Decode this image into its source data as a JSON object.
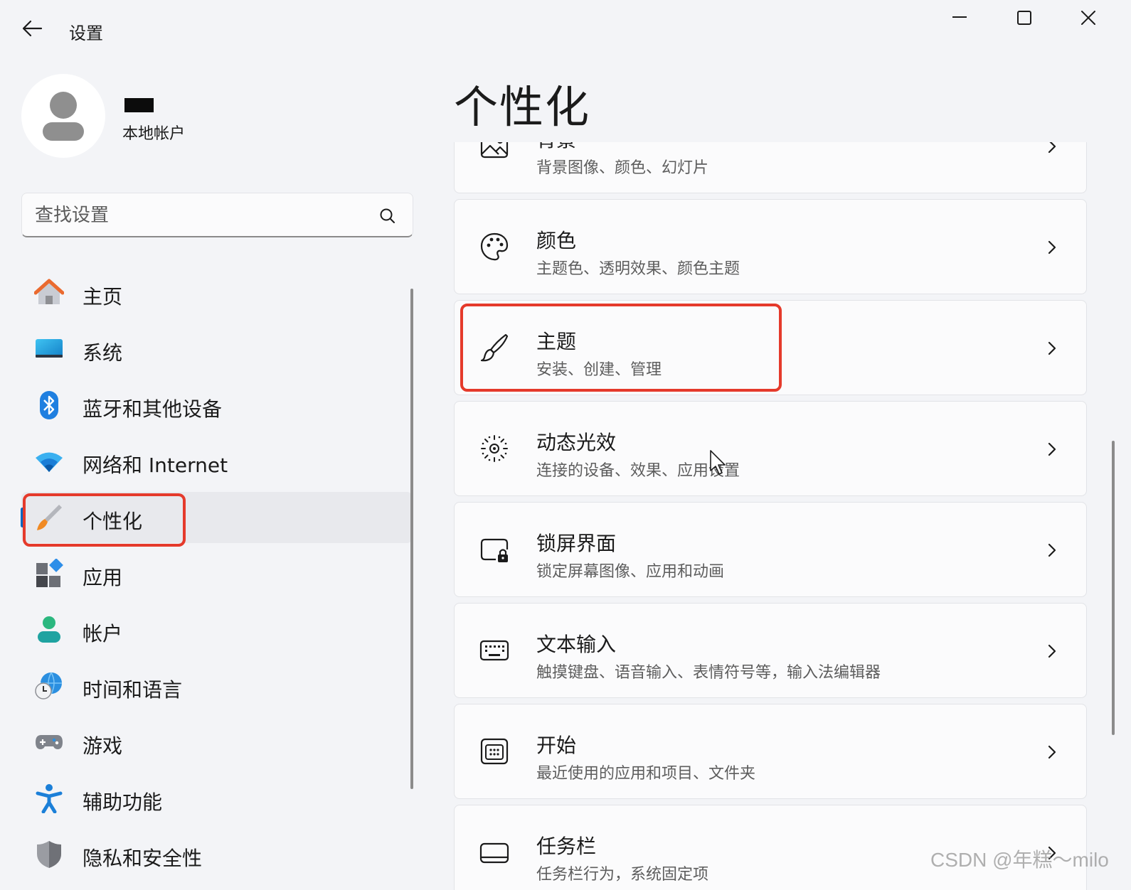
{
  "window": {
    "title": "设置",
    "controls": [
      "minimize",
      "maximize",
      "close"
    ]
  },
  "account": {
    "type": "本地帐户"
  },
  "search": {
    "placeholder": "查找设置"
  },
  "nav": {
    "items": [
      {
        "label": "主页",
        "icon": "home-icon"
      },
      {
        "label": "系统",
        "icon": "monitor-icon"
      },
      {
        "label": "蓝牙和其他设备",
        "icon": "bluetooth-icon"
      },
      {
        "label": "网络和 Internet",
        "icon": "wifi-icon"
      },
      {
        "label": "个性化",
        "icon": "paintbrush-icon",
        "selected": true
      },
      {
        "label": "应用",
        "icon": "apps-icon"
      },
      {
        "label": "帐户",
        "icon": "person-icon"
      },
      {
        "label": "时间和语言",
        "icon": "globe-clock-icon"
      },
      {
        "label": "游戏",
        "icon": "gamepad-icon"
      },
      {
        "label": "辅助功能",
        "icon": "accessibility-icon"
      },
      {
        "label": "隐私和安全性",
        "icon": "shield-icon"
      }
    ]
  },
  "page": {
    "title": "个性化"
  },
  "cards": [
    {
      "title": "背景",
      "description": "背景图像、颜色、幻灯片",
      "icon": "image-icon"
    },
    {
      "title": "颜色",
      "description": "主题色、透明效果、颜色主题",
      "icon": "palette-icon"
    },
    {
      "title": "主题",
      "description": "安装、创建、管理",
      "icon": "brush-icon",
      "highlighted": true
    },
    {
      "title": "动态光效",
      "description": "连接的设备、效果、应用设置",
      "icon": "dynamic-lighting-icon"
    },
    {
      "title": "锁屏界面",
      "description": "锁定屏幕图像、应用和动画",
      "icon": "lock-screen-icon"
    },
    {
      "title": "文本输入",
      "description": "触摸键盘、语音输入、表情符号等，输入法编辑器",
      "icon": "keyboard-icon"
    },
    {
      "title": "开始",
      "description": "最近使用的应用和项目、文件夹",
      "icon": "start-icon"
    },
    {
      "title": "任务栏",
      "description": "任务栏行为，系统固定项",
      "icon": "taskbar-icon"
    }
  ],
  "watermark": "CSDN @年糕～milo",
  "colors": {
    "accent": "#0067c0",
    "highlight": "#e53a2b",
    "background": "#f3f4f7",
    "card": "#fbfbfc"
  }
}
